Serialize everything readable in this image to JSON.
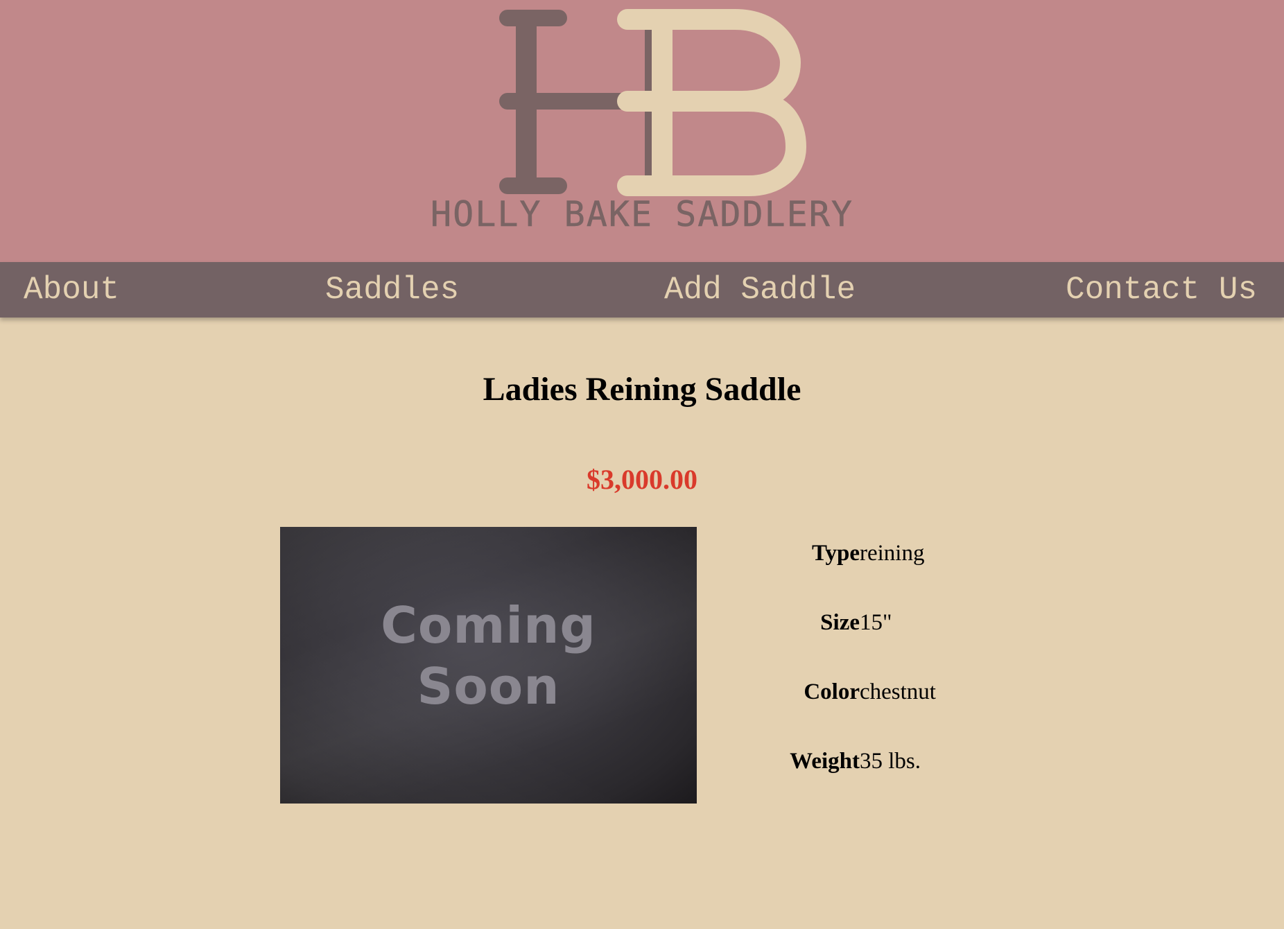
{
  "header": {
    "logo_monogram": "HB",
    "logo_name": "HOLLY BAKE SADDLERY",
    "colors": {
      "background": "#c1888a",
      "monogram_h": "#7a6464",
      "monogram_b": "#e4d1b1"
    }
  },
  "nav": {
    "items": [
      {
        "label": "About"
      },
      {
        "label": "Saddles"
      },
      {
        "label": "Add Saddle"
      },
      {
        "label": "Contact Us"
      }
    ],
    "colors": {
      "background": "#736264",
      "text": "#e4d1b1"
    }
  },
  "product": {
    "title": "Ladies Reining Saddle",
    "price": "$3,000.00",
    "image_caption": "Coming Soon",
    "specs": [
      {
        "label": "Type",
        "value": "reining"
      },
      {
        "label": "Size",
        "value": "15\""
      },
      {
        "label": "Color",
        "value": "chestnut"
      },
      {
        "label": "Weight",
        "value": "35 lbs."
      }
    ],
    "colors": {
      "price": "#d93a2b",
      "page_background": "#e4d1b1"
    }
  }
}
